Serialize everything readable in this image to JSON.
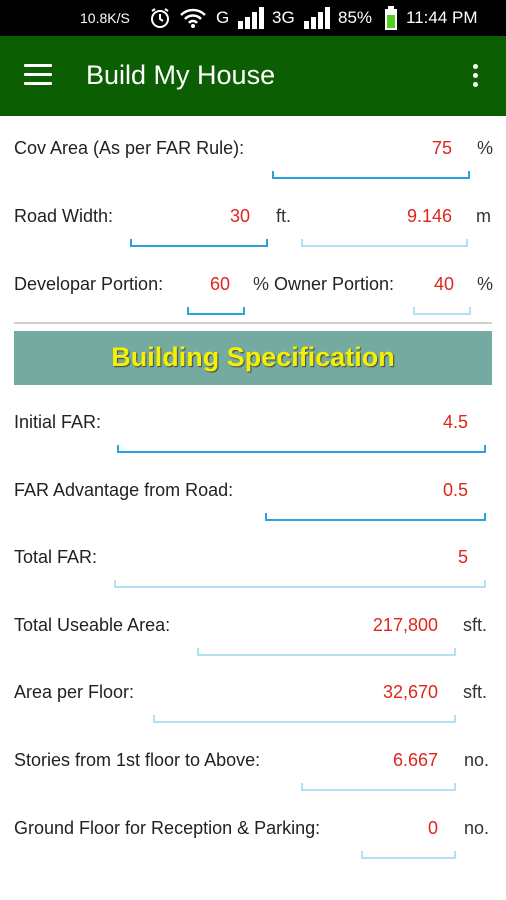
{
  "status_bar": {
    "net_speed": "10.8K/S",
    "signal_1": "G",
    "signal_2": "3G",
    "battery": "85%",
    "time": "11:44 PM"
  },
  "app_bar": {
    "title": "Build My House",
    "menu_icon": "hamburger-menu",
    "overflow_icon": "more-vertical"
  },
  "rows": {
    "cov_area": {
      "label": "Cov Area (As per FAR Rule):",
      "value": "75",
      "unit": "%"
    },
    "road_width": {
      "label": "Road Width:",
      "value_ft": "30",
      "unit_ft": "ft.",
      "value_m": "9.146",
      "unit_m": "m"
    },
    "portion": {
      "developer_label": "Developar Portion:",
      "developer_value": "60",
      "developer_unit": "%",
      "owner_label": "Owner Portion:",
      "owner_value": "40",
      "owner_unit": "%"
    }
  },
  "section": {
    "title": "Building Specification"
  },
  "spec": {
    "initial_far": {
      "label": "Initial FAR:",
      "value": "4.5"
    },
    "far_advantage": {
      "label": "FAR Advantage from Road:",
      "value": "0.5"
    },
    "total_far": {
      "label": "Total FAR:",
      "value": "5"
    },
    "useable_area": {
      "label": "Total Useable Area:",
      "value": "217,800",
      "unit": "sft."
    },
    "area_per_floor": {
      "label": "Area per Floor:",
      "value": "32,670",
      "unit": "sft."
    },
    "stories": {
      "label": "Stories from 1st floor to Above:",
      "value": "6.667",
      "unit": "no."
    },
    "ground_floor": {
      "label": "Ground Floor for Reception & Parking:",
      "value": "0",
      "unit": "no."
    }
  },
  "colors": {
    "app_bar": "#0b5e02",
    "section_header": "#75aaa1",
    "section_title": "#f5f000",
    "value_text": "#e0251b",
    "field_underline": "#29a3df"
  }
}
